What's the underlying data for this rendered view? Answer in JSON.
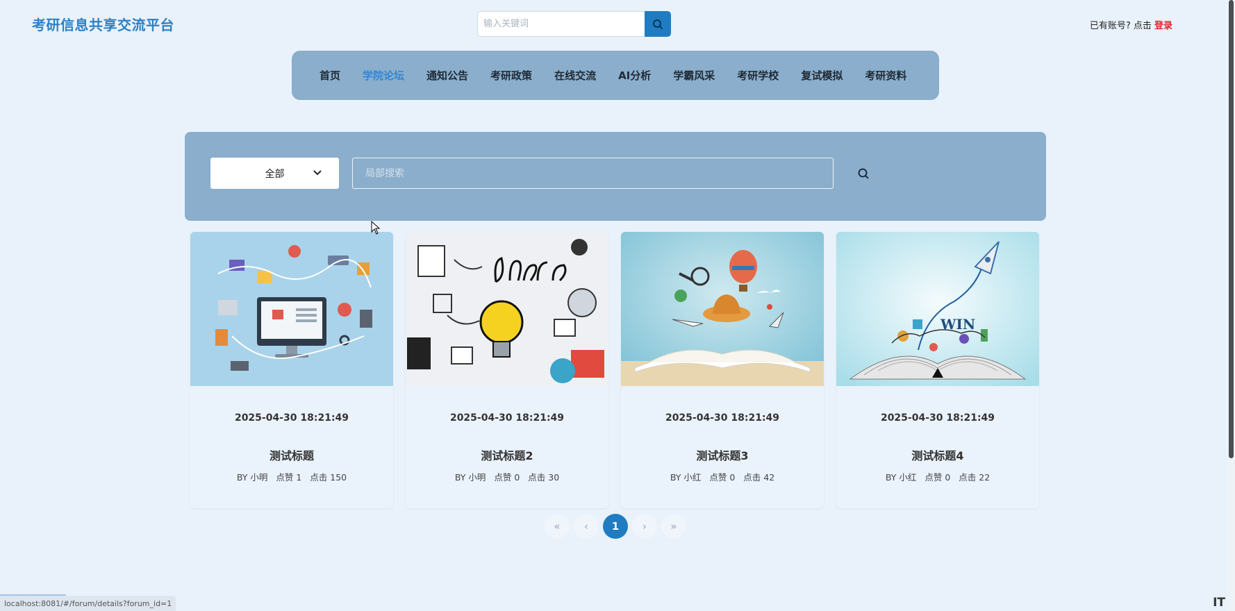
{
  "header": {
    "site_title": "考研信息共享交流平台",
    "search_placeholder": "输入关键词",
    "login_prompt": "已有账号? 点击 ",
    "login_link": "登录"
  },
  "nav": {
    "items": [
      "首页",
      "学院论坛",
      "通知公告",
      "考研政策",
      "在线交流",
      "AI分析",
      "学霸风采",
      "考研学校",
      "复试模拟",
      "考研资料"
    ],
    "active": "学院论坛"
  },
  "filter": {
    "select_value": "全部",
    "search_placeholder": "局部搜索"
  },
  "posts": [
    {
      "date": "2025-04-30 18:21:49",
      "title": "测试标题",
      "author": "BY 小明",
      "likes": "点赞 1",
      "clicks": "点击 150",
      "image": "ecommerce-illustration"
    },
    {
      "date": "2025-04-30 18:21:49",
      "title": "测试标题2",
      "author": "BY 小明",
      "likes": "点赞 0",
      "clicks": "点击 30",
      "image": "learn-lightbulb-illustration"
    },
    {
      "date": "2025-04-30 18:21:49",
      "title": "测试标题3",
      "author": "BY 小红",
      "likes": "点赞 0",
      "clicks": "点击 42",
      "image": "open-book-travel-illustration"
    },
    {
      "date": "2025-04-30 18:21:49",
      "title": "测试标题4",
      "author": "BY 小红",
      "likes": "点赞 0",
      "clicks": "点击 22",
      "image": "book-rocket-win-illustration"
    }
  ],
  "pagination": {
    "first": "«",
    "prev": "‹",
    "current": "1",
    "next": "›",
    "last": "»"
  },
  "status_bar": {
    "url": "localhost:8081/#/forum/details?forum_id=1"
  },
  "watermark": "IT",
  "colors": {
    "brand": "#2f80c3",
    "accent_button": "#1f7cc1",
    "panel": "#8aaecb",
    "background": "#e9f2fb",
    "login_link": "#e0262d"
  }
}
